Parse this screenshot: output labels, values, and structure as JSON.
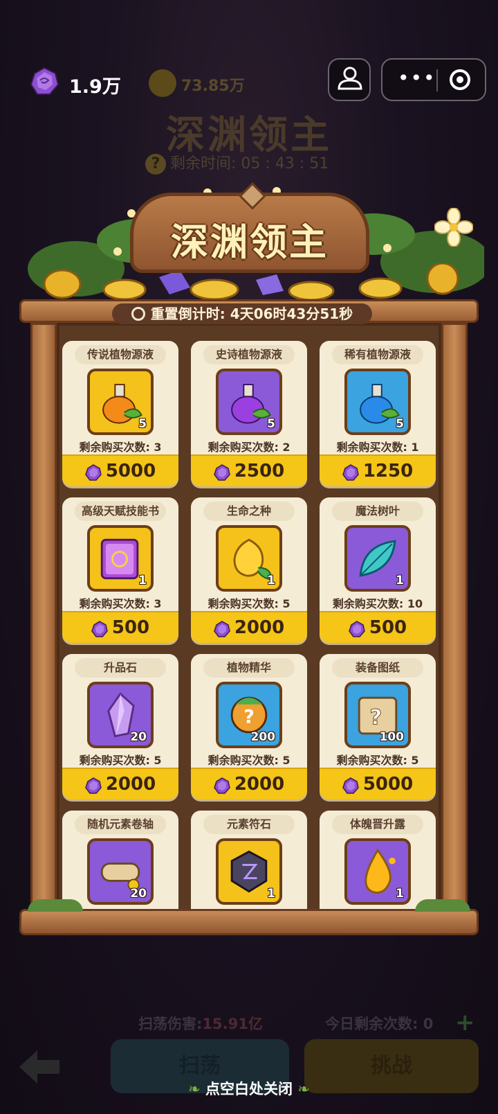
{
  "top_bar": {
    "gem_count": "1.9万",
    "user_icon": "person-icon",
    "menu_icon": "more-dots-icon",
    "close_icon": "target-circle-icon"
  },
  "background": {
    "coin_count": "73.85万",
    "boss_title": "深渊领主",
    "remaining_time": "剩余时间: 05 : 43 : 51",
    "sweep_damage_label": "扫荡伤害:",
    "sweep_damage_value": "15.91亿",
    "remaining_today": "今日剩余次数: 0",
    "sweep_button": "扫荡",
    "challenge_button": "挑战"
  },
  "shop": {
    "title": "深渊领主",
    "reset_countdown": "重置倒计时: 4天06时43分51秒",
    "items": [
      {
        "name": "传说植物源液",
        "qty": "5",
        "remaining": "剩余购买次数: 3",
        "price": "5000",
        "frame": "gold",
        "icon": "legendary-potion-icon"
      },
      {
        "name": "史诗植物源液",
        "qty": "5",
        "remaining": "剩余购买次数: 2",
        "price": "2500",
        "frame": "purple",
        "icon": "epic-potion-icon"
      },
      {
        "name": "稀有植物源液",
        "qty": "5",
        "remaining": "剩余购买次数: 1",
        "price": "1250",
        "frame": "blue",
        "icon": "rare-potion-icon"
      },
      {
        "name": "高级天赋技能书",
        "qty": "1",
        "remaining": "剩余购买次数: 3",
        "price": "500",
        "frame": "gold",
        "icon": "skill-book-icon"
      },
      {
        "name": "生命之种",
        "qty": "1",
        "remaining": "剩余购买次数: 5",
        "price": "2000",
        "frame": "gold",
        "icon": "life-seed-icon"
      },
      {
        "name": "魔法树叶",
        "qty": "1",
        "remaining": "剩余购买次数: 10",
        "price": "500",
        "frame": "purple",
        "icon": "magic-leaf-icon"
      },
      {
        "name": "升品石",
        "qty": "20",
        "remaining": "剩余购买次数: 5",
        "price": "2000",
        "frame": "purple",
        "icon": "upgrade-crystal-icon"
      },
      {
        "name": "植物精华",
        "qty": "200",
        "remaining": "剩余购买次数: 5",
        "price": "2000",
        "frame": "blue",
        "icon": "plant-essence-icon"
      },
      {
        "name": "装备图纸",
        "qty": "100",
        "remaining": "剩余购买次数: 5",
        "price": "5000",
        "frame": "blue",
        "icon": "blueprint-scroll-icon"
      },
      {
        "name": "随机元素卷轴",
        "qty": "20",
        "remaining": "",
        "price": "",
        "frame": "purple",
        "icon": "element-scroll-icon"
      },
      {
        "name": "元素符石",
        "qty": "1",
        "remaining": "",
        "price": "",
        "frame": "gold",
        "icon": "rune-stone-icon"
      },
      {
        "name": "体魄晋升露",
        "qty": "1",
        "remaining": "",
        "price": "",
        "frame": "purple",
        "icon": "dew-drop-icon"
      }
    ]
  },
  "close_hint": "点空白处关闭",
  "colors": {
    "gold_frame": "#f4c21a",
    "purple_frame": "#8a5ad8",
    "blue_frame": "#3aa3e0",
    "price_bar": "#f5c517",
    "card_bg": "#f5ecd6"
  }
}
